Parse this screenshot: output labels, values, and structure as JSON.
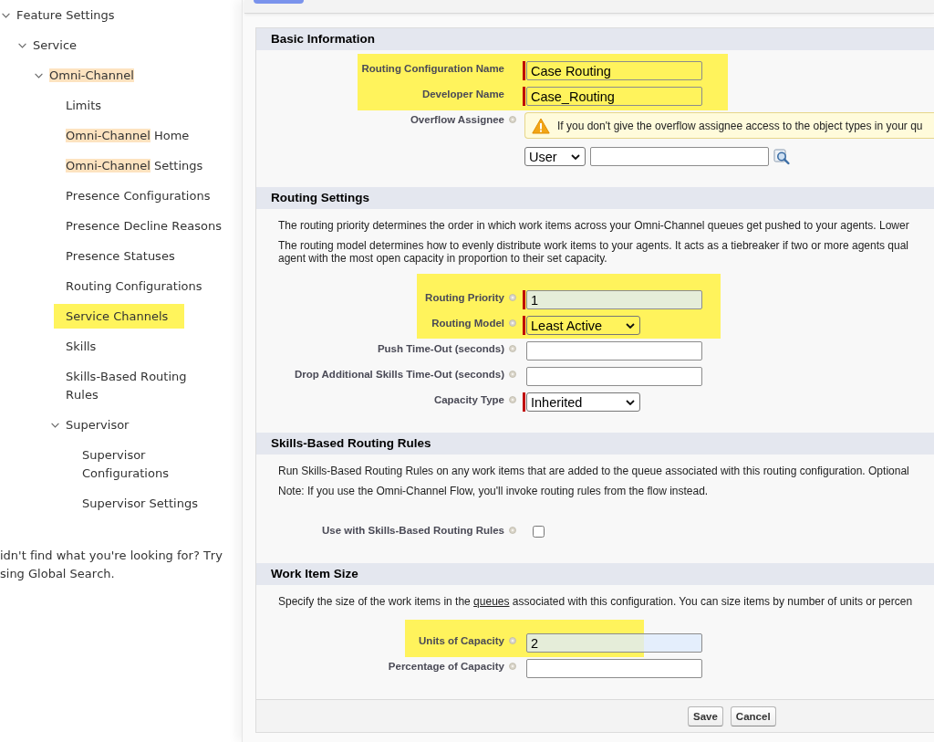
{
  "sidebar": {
    "items": [
      {
        "parts": [
          {
            "text": "Feature Settings",
            "match": false
          }
        ],
        "expanded": true,
        "highlighted": false,
        "children": [
          {
            "parts": [
              {
                "text": "Service",
                "match": false
              }
            ],
            "expanded": true,
            "highlighted": false,
            "children": [
              {
                "parts": [
                  {
                    "text": "Omni-Channel",
                    "match": true
                  }
                ],
                "expanded": true,
                "highlighted": false,
                "children": [
                  {
                    "parts": [
                      {
                        "text": "Limits",
                        "match": false
                      }
                    ],
                    "highlighted": false
                  },
                  {
                    "parts": [
                      {
                        "text": "Omni-Channel",
                        "match": true
                      },
                      {
                        "text": " Home",
                        "match": false
                      }
                    ],
                    "highlighted": false
                  },
                  {
                    "parts": [
                      {
                        "text": "Omni-Channel",
                        "match": true
                      },
                      {
                        "text": " Settings",
                        "match": false
                      }
                    ],
                    "highlighted": false
                  },
                  {
                    "parts": [
                      {
                        "text": "Presence Configurations",
                        "match": false
                      }
                    ],
                    "highlighted": false
                  },
                  {
                    "parts": [
                      {
                        "text": "Presence Decline Reasons",
                        "match": false
                      }
                    ],
                    "highlighted": false
                  },
                  {
                    "parts": [
                      {
                        "text": "Presence Statuses",
                        "match": false
                      }
                    ],
                    "highlighted": false
                  },
                  {
                    "parts": [
                      {
                        "text": "Routing Configurations",
                        "match": false
                      }
                    ],
                    "highlighted": false
                  },
                  {
                    "parts": [
                      {
                        "text": "Service Channels",
                        "match": false
                      }
                    ],
                    "highlighted": true
                  },
                  {
                    "parts": [
                      {
                        "text": "Skills",
                        "match": false
                      }
                    ],
                    "highlighted": false
                  },
                  {
                    "parts": [
                      {
                        "text": "Skills-Based Routing Rules",
                        "match": false
                      }
                    ],
                    "highlighted": false
                  },
                  {
                    "parts": [
                      {
                        "text": "Supervisor",
                        "match": false
                      }
                    ],
                    "expanded": true,
                    "highlighted": false,
                    "children": [
                      {
                        "parts": [
                          {
                            "text": "Supervisor Configurations",
                            "match": false
                          }
                        ],
                        "highlighted": false
                      },
                      {
                        "parts": [
                          {
                            "text": "Supervisor Settings",
                            "match": false
                          }
                        ],
                        "highlighted": false
                      }
                    ]
                  }
                ]
              }
            ]
          }
        ]
      }
    ],
    "hint_lines": [
      "idn't find what you're looking for? Try",
      "sing Global Search."
    ]
  },
  "form": {
    "sections": [
      {
        "title": "Basic Information",
        "fields": [
          {
            "kind": "text",
            "label": "Routing Configuration Name",
            "help": false,
            "required": true,
            "highlighted": true,
            "autofilled": false,
            "value": "Case Routing"
          },
          {
            "kind": "text",
            "label": "Developer Name",
            "help": false,
            "required": true,
            "highlighted": true,
            "autofilled": false,
            "value": "Case_Routing"
          },
          {
            "kind": "lookup",
            "label": "Overflow Assignee",
            "help": true,
            "required": false,
            "highlighted": false,
            "warning": "If you don't give the overflow assignee access to the object types in your qu",
            "type_value": "User"
          }
        ]
      },
      {
        "title": "Routing Settings",
        "paragraphs": [
          {
            "lines": [
              {
                "segments": [
                  {
                    "text": "The routing priority determines the order in which work items across your Omni-Channel queues get pushed to your agents. Lower",
                    "link": false
                  }
                ]
              }
            ]
          },
          {
            "lines": [
              {
                "segments": [
                  {
                    "text": "The routing model determines how to evenly distribute work items to your agents. It acts as a tiebreaker if two or more agents qual",
                    "link": false
                  }
                ]
              },
              {
                "segments": [
                  {
                    "text": "agent with the most open capacity in proportion to their set capacity.",
                    "link": false
                  }
                ]
              }
            ]
          }
        ],
        "fields": [
          {
            "kind": "text",
            "label": "Routing Priority",
            "help": true,
            "required": true,
            "highlighted": true,
            "autofilled": true,
            "value": "1"
          },
          {
            "kind": "select",
            "label": "Routing Model",
            "help": true,
            "required": true,
            "highlighted": true,
            "value": "Least Active"
          },
          {
            "kind": "text",
            "label": "Push Time-Out (seconds)",
            "help": true,
            "required": false,
            "highlighted": false,
            "autofilled": false
          },
          {
            "kind": "text",
            "label": "Drop Additional Skills Time-Out (seconds)",
            "help": true,
            "required": false,
            "highlighted": false,
            "autofilled": false
          },
          {
            "kind": "select",
            "label": "Capacity Type",
            "help": true,
            "required": true,
            "highlighted": false,
            "value": "Inherited"
          }
        ]
      },
      {
        "title": "Skills-Based Routing Rules",
        "paragraphs": [
          {
            "lines": [
              {
                "segments": [
                  {
                    "text": "Run Skills-Based Routing Rules on any work items that are added to the queue associated with this routing configuration. Optional",
                    "link": false
                  }
                ]
              }
            ]
          },
          {
            "lines": [
              {
                "segments": [
                  {
                    "text": "Note: If you use the Omni-Channel Flow, you'll invoke routing rules from the flow instead.",
                    "link": false
                  }
                ]
              }
            ]
          }
        ],
        "fields": [
          {
            "kind": "checkbox",
            "label": "Use with Skills-Based Routing Rules",
            "help": true,
            "required": false,
            "highlighted": false,
            "checked": false
          }
        ]
      },
      {
        "title": "Work Item Size",
        "paragraphs": [
          {
            "lines": [
              {
                "segments": [
                  {
                    "text": "Specify the size of the work items in the ",
                    "link": false
                  },
                  {
                    "text": "queues",
                    "link": true
                  },
                  {
                    "text": " associated with this configuration. You can size items by number of units or percen",
                    "link": false
                  }
                ]
              }
            ]
          }
        ],
        "fields": [
          {
            "kind": "text",
            "label": "Units of Capacity",
            "help": true,
            "required": false,
            "highlighted": true,
            "autofilled": true,
            "value": "2"
          },
          {
            "kind": "text",
            "label": "Percentage of Capacity",
            "help": true,
            "required": false,
            "highlighted": false,
            "autofilled": false
          }
        ]
      }
    ],
    "buttons": [
      "Save",
      "Cancel"
    ]
  }
}
